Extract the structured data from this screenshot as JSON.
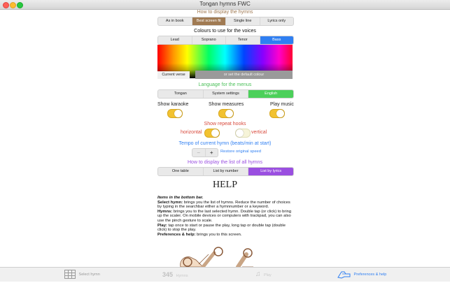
{
  "window": {
    "title": "Tongan hymns FWC"
  },
  "display": {
    "heading": "How to display the hymns",
    "options": [
      "As in book",
      "Best screen fit",
      "Single line",
      "Lyrics only"
    ],
    "selected": "Best screen fit"
  },
  "colours": {
    "heading": "Colours to use for the voices",
    "voices": [
      "Lead",
      "Soprano",
      "Tenor",
      "Bass"
    ],
    "selected": "Bass",
    "current_verse": "Current verse",
    "default_button": "or set the default colour"
  },
  "language": {
    "heading": "Language for the menus",
    "options": [
      "Tongan",
      "System settings",
      "English"
    ],
    "selected": "English"
  },
  "toggles": {
    "karaoke": {
      "label": "Show karaoke",
      "on": true
    },
    "measures": {
      "label": "Show measures",
      "on": true
    },
    "play": {
      "label": "Play music",
      "on": true
    }
  },
  "repeat": {
    "heading": "Show repeat hooks",
    "horizontal": {
      "label": "horizontal",
      "on": true
    },
    "vertical": {
      "label": "vertical",
      "on": false
    }
  },
  "tempo": {
    "heading": "Tempo of current hymn (beats/min at start)",
    "minus": "−",
    "plus": "+",
    "restore": "Restore original speed"
  },
  "list": {
    "heading": "How to display the list of all hymns",
    "options": [
      "One table",
      "List by number",
      "List by lyrics"
    ],
    "selected": "List by lyrics"
  },
  "help": {
    "title": "HELP",
    "intro": "Items in the bottom bar.",
    "items": [
      {
        "term": "Select hymn:",
        "text": " brings you the list of hymns. Reduce the number of choices by typing in the searchbar either a hymnnumber or a keyword."
      },
      {
        "term": "Hymns:",
        "text": " brings you to the last selected hymn. Double tap (or click) to bring up the scaler. On mobile devices or computers with trackpad, you can also use the pinch gesture to scale."
      },
      {
        "term": "Play:",
        "text": " tap once to start or pause the play, long tap or double tap (double click) to stop the play."
      },
      {
        "term": "Preferences & help:",
        "text": " brings you to this screen."
      }
    ]
  },
  "tabbar": {
    "select": "Select hymn",
    "hymns": "Hymns",
    "play": "Play",
    "prefs": "Preferences & help"
  },
  "colors": {
    "brown": "#a07a52",
    "blue": "#2f7ff2",
    "green": "#4cd05a",
    "purple": "#9a4fe0",
    "toggle": "#f2c230"
  }
}
